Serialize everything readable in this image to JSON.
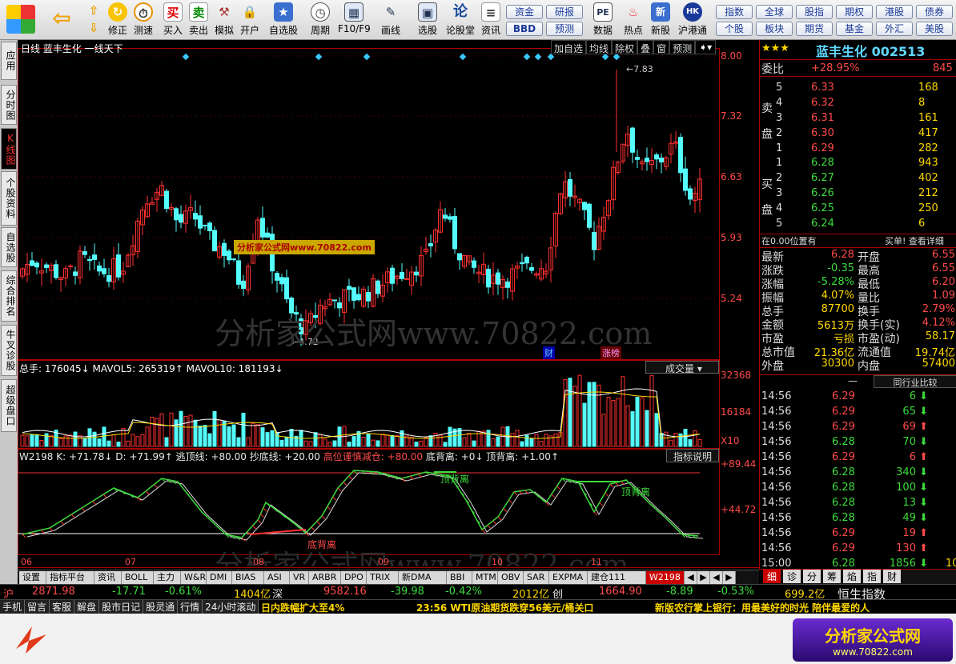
{
  "toolbar": {
    "items": [
      "修正",
      "测速",
      "买入",
      "卖出",
      "模拟",
      "开户",
      "自选股",
      "周期",
      "F10/F9",
      "画线",
      "选股",
      "论股堂",
      "资讯",
      "数据",
      "热点",
      "新股",
      "沪港通"
    ],
    "right_top": [
      "资金",
      "研报"
    ],
    "right_bot": [
      "BBD",
      "预测"
    ],
    "icon_glyphs": {
      "back": "⇦",
      "up": "⇧",
      "down": "⇩",
      "refresh": "↻",
      "clock": "⏱",
      "buy": "买",
      "sell": "卖",
      "hammer": "⚒",
      "lock": "🔒",
      "pe": "PE",
      "new": "新",
      "hk": "HK"
    },
    "idx_row1": [
      "指数",
      "全球",
      "股指",
      "期权",
      "港股",
      "债券"
    ],
    "idx_row2": [
      "个股",
      "板块",
      "期货",
      "基金",
      "外汇",
      "美股"
    ]
  },
  "sidetabs": [
    "应用",
    "分时图",
    "K线图",
    "个股资料",
    "自选股",
    "综合排名",
    "牛叉诊股",
    "超级盘口"
  ],
  "sidetab_active": "K线图",
  "chart": {
    "header_left": "日线 蓝丰生化 一线天下",
    "header_buttons": [
      "加自选",
      "均线",
      "除权",
      "叠",
      "窗",
      "预测"
    ],
    "price_ticks": [
      "8.00",
      "7.32",
      "6.63",
      "5.93",
      "5.24"
    ],
    "high_label": "7.83",
    "low_label": "4.72",
    "watermark": "分析家公式网www.70822.com",
    "small_watermark": "分析家公式网www.70822.com",
    "markers": [
      "财",
      "涨榜"
    ],
    "vol_title": "总手: 176045↓ MAVOL5: 265319↑ MAVOL10: 181193↓",
    "vol_selector": "成交量",
    "vol_ticks": [
      "32368",
      "16184",
      "X10"
    ],
    "ind_title": "W2198 K: +71.78↓ D: +71.99↑ 逃顶线: +80.00 抄底线: +20.00",
    "ind_title_red": "高位谨慎减仓: +80.00",
    "ind_title_tail": "底背离: +0↓ 顶背离: +1.00↑",
    "ind_button": "指标说明",
    "ind_ticks": [
      "+89.44",
      "+44.72"
    ],
    "ind_labels": [
      "顶背离",
      "顶背离",
      "底背离"
    ],
    "months": [
      "06",
      "07",
      "08",
      "09",
      "10",
      "11"
    ]
  },
  "bottomtabs": [
    "设置",
    "指标平台",
    "资讯",
    "BOLL",
    "主力",
    "W&R",
    "DMI",
    "BIAS",
    "ASI",
    "VR",
    "ARBR",
    "DPO",
    "TRIX",
    "新DMA",
    "BBI",
    "MTM",
    "OBV",
    "SAR",
    "EXPMA",
    "建仓111",
    "W2198"
  ],
  "quote": {
    "stars": "★★★",
    "name": "蓝丰生化",
    "code": "002513",
    "weibi_label": "委比",
    "weibi": "+28.95%",
    "weibi_right": "845",
    "sell_label": "卖盘",
    "buy_label": "买盘",
    "sells": [
      {
        "n": "5",
        "p": "6.33",
        "v": "168"
      },
      {
        "n": "4",
        "p": "6.32",
        "v": "8"
      },
      {
        "n": "3",
        "p": "6.31",
        "v": "161"
      },
      {
        "n": "2",
        "p": "6.30",
        "v": "417"
      },
      {
        "n": "1",
        "p": "6.29",
        "v": "282"
      }
    ],
    "buys": [
      {
        "n": "1",
        "p": "6.28",
        "v": "943"
      },
      {
        "n": "2",
        "p": "6.27",
        "v": "402"
      },
      {
        "n": "3",
        "p": "6.26",
        "v": "212"
      },
      {
        "n": "4",
        "p": "6.25",
        "v": "250"
      },
      {
        "n": "5",
        "p": "6.24",
        "v": "6"
      }
    ],
    "pos_left": "在0.00位置有",
    "pos_right": "买单! 查看详细",
    "stats": [
      [
        "最新",
        "6.28",
        "开盘",
        "6.55"
      ],
      [
        "涨跌",
        "-0.35",
        "最高",
        "6.55"
      ],
      [
        "涨幅",
        "-5.28%",
        "最低",
        "6.20"
      ],
      [
        "振幅",
        "4.07%",
        "量比",
        "1.09"
      ],
      [
        "总手",
        "87700",
        "换手",
        "2.79%"
      ],
      [
        "金额",
        "5613万",
        "换手(实)",
        "4.12%"
      ],
      [
        "市盈",
        "亏损",
        "市盈(动)",
        "58.17"
      ],
      [
        "总市值",
        "21.36亿",
        "流通值",
        "19.74亿"
      ],
      [
        "外盘",
        "30300",
        "内盘",
        "57400"
      ]
    ],
    "compare_btn": "同行业比较",
    "ticks": [
      [
        "14:56",
        "6.29",
        "6",
        "d"
      ],
      [
        "14:56",
        "6.29",
        "65",
        "d"
      ],
      [
        "14:56",
        "6.29",
        "69",
        "u"
      ],
      [
        "14:56",
        "6.28",
        "70",
        "d"
      ],
      [
        "14:56",
        "6.29",
        "6",
        "u"
      ],
      [
        "14:56",
        "6.28",
        "340",
        "d"
      ],
      [
        "14:56",
        "6.28",
        "100",
        "d"
      ],
      [
        "14:56",
        "6.28",
        "13",
        "d"
      ],
      [
        "14:56",
        "6.28",
        "49",
        "d"
      ],
      [
        "14:56",
        "6.29",
        "19",
        "u"
      ],
      [
        "14:56",
        "6.29",
        "130",
        "u"
      ],
      [
        "15:00",
        "6.28",
        "1856",
        "d"
      ]
    ],
    "last_vol": "10",
    "right_tabs": [
      "细",
      "诊",
      "分",
      "筹",
      "焰",
      "指",
      "财"
    ]
  },
  "idx": {
    "sh_label": "沪",
    "sh": "2871.98",
    "sh_chg": "-17.71",
    "sh_pct": "-0.61%",
    "sh_amt": "1404亿",
    "sz_label": "深",
    "sz": "9582.16",
    "sz_chg": "-39.98",
    "sz_pct": "-0.42%",
    "sz_amt": "2012亿",
    "cy_label": "创",
    "cy": "1664.90",
    "cy_chg": "-8.89",
    "cy_pct": "-0.53%",
    "cy_amt": "699.2亿",
    "hs": "恒生指数"
  },
  "news": {
    "tabs": [
      "手机",
      "留言",
      "客服",
      "解盘",
      "股市日记",
      "股灵通",
      "行情",
      "24小时滚动"
    ],
    "n1": "日内跌幅扩大至4%",
    "n2": "23:56 WTI原油期货跌穿56美元/桶关口",
    "n3": "新版农行掌上银行：用最美好的时光 陪伴最爱的人"
  },
  "logo": {
    "name": "分析家公式网",
    "url": "www.70822.com"
  }
}
